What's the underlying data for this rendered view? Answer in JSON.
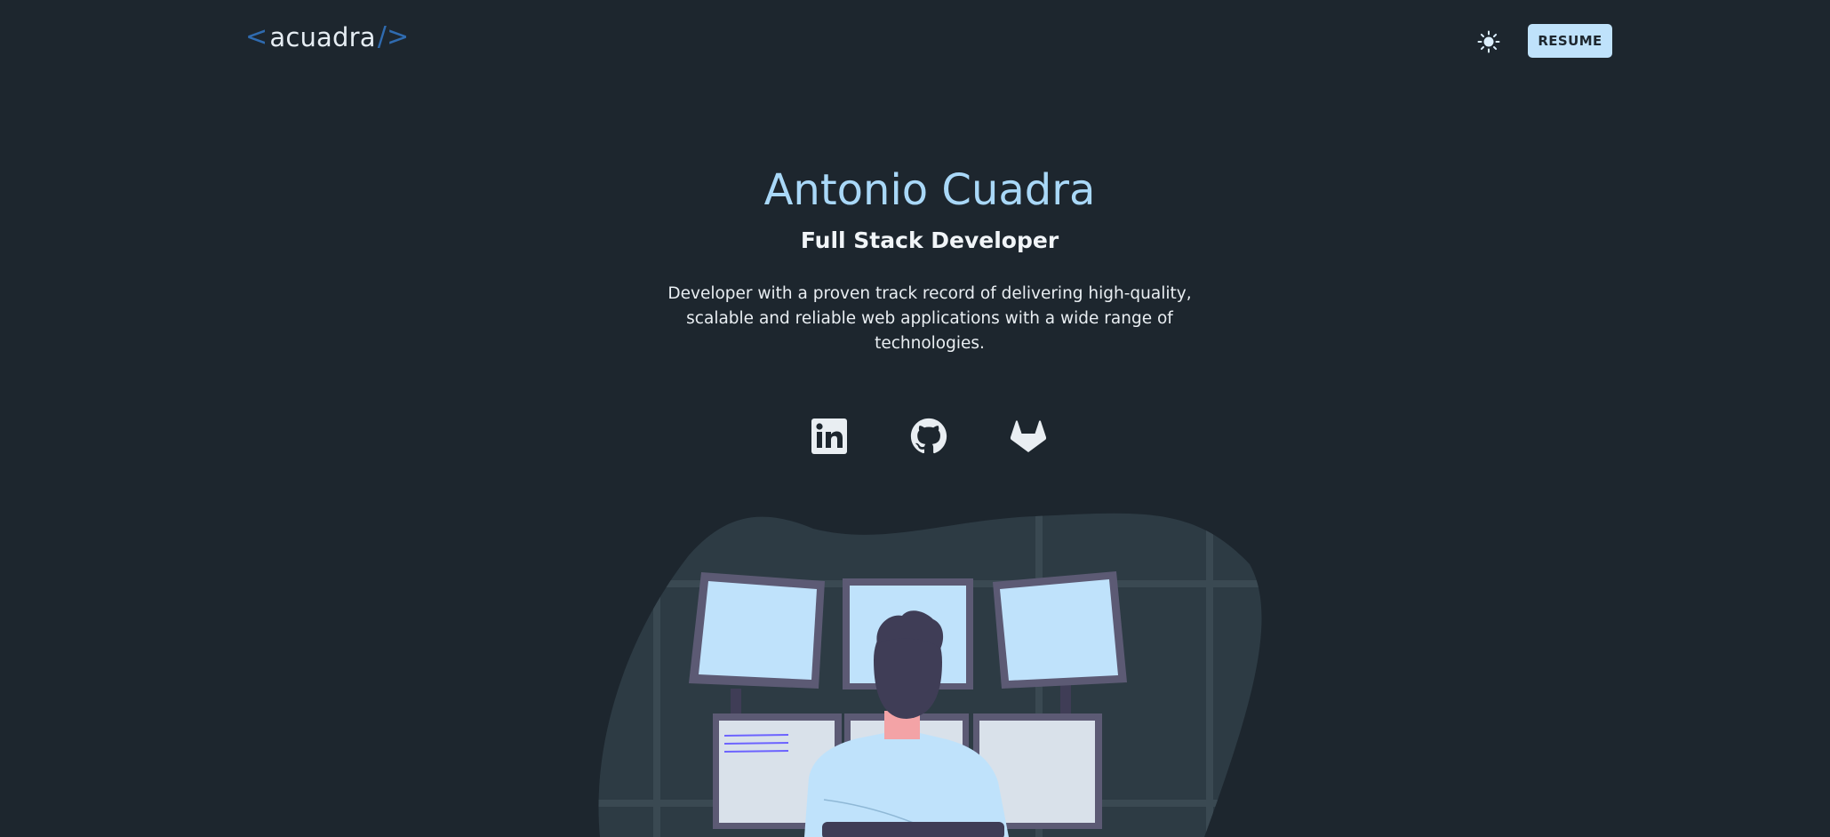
{
  "header": {
    "logo": {
      "open_bracket": "<",
      "text": "acuadra",
      "close_bracket": "/>"
    },
    "theme_toggle_icon": "sun-icon",
    "resume_label": "RESUME"
  },
  "hero": {
    "name": "Antonio Cuadra",
    "role": "Full Stack Developer",
    "description": "Developer with a proven track record of delivering high-quality, scalable and reliable web applications with a wide range of technologies."
  },
  "socials": [
    {
      "icon": "linkedin-icon"
    },
    {
      "icon": "github-icon"
    },
    {
      "icon": "gitlab-icon"
    }
  ],
  "colors": {
    "background": "#1d262e",
    "accent": "#a9d8f8",
    "button": "#bfe2fb",
    "logo_bracket": "#2f6bb0"
  }
}
